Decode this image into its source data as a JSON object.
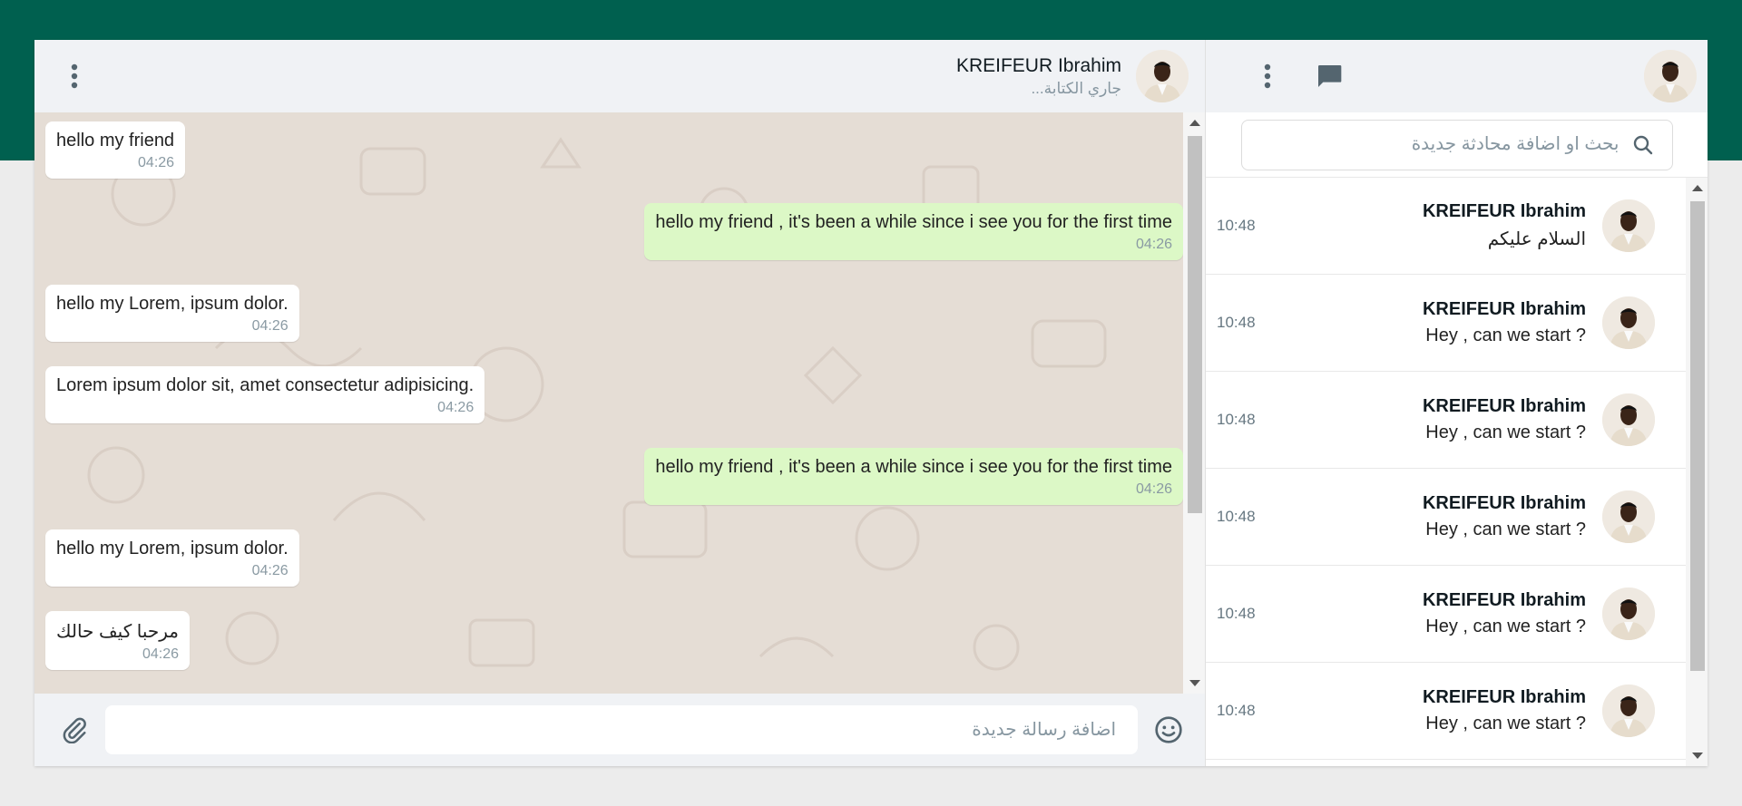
{
  "chat": {
    "contact_name": "KREIFEUR Ibrahim",
    "contact_status": "جاري الكتابة...",
    "messages": [
      {
        "text": "hello my friend",
        "time": "04:26",
        "direction": "in"
      },
      {
        "text": "hello my friend , it's been a while since i see you for the first time",
        "time": "04:26",
        "direction": "out"
      },
      {
        "text": "hello my Lorem, ipsum dolor.",
        "time": "04:26",
        "direction": "in"
      },
      {
        "text": "Lorem ipsum dolor sit, amet consectetur adipisicing.",
        "time": "04:26",
        "direction": "in"
      },
      {
        "text": "hello my friend , it's been a while since i see you for the first time",
        "time": "04:26",
        "direction": "out"
      },
      {
        "text": "hello my Lorem, ipsum dolor.",
        "time": "04:26",
        "direction": "in"
      },
      {
        "text": "مرحبا كيف حالك",
        "time": "04:26",
        "direction": "in"
      }
    ],
    "composer_placeholder": "اضافة رسالة جديدة"
  },
  "sidebar": {
    "search_placeholder": "بحث او اضافة محادثة جديدة",
    "conversations": [
      {
        "name": "KREIFEUR Ibrahim",
        "preview": "السلام عليكم",
        "time": "10:48"
      },
      {
        "name": "KREIFEUR Ibrahim",
        "preview": "Hey , can we start ?",
        "time": "10:48"
      },
      {
        "name": "KREIFEUR Ibrahim",
        "preview": "Hey , can we start ?",
        "time": "10:48"
      },
      {
        "name": "KREIFEUR Ibrahim",
        "preview": "Hey , can we start ?",
        "time": "10:48"
      },
      {
        "name": "KREIFEUR Ibrahim",
        "preview": "Hey , can we start ?",
        "time": "10:48"
      },
      {
        "name": "KREIFEUR Ibrahim",
        "preview": "Hey , can we start ?",
        "time": "10:48"
      }
    ]
  },
  "colors": {
    "brand": "#00604f",
    "outgoing_bubble": "#dcf8c6",
    "incoming_bubble": "#ffffff",
    "chat_background": "#e5ddd5"
  },
  "icons": {
    "chat_menu": "vertical-dots-icon",
    "side_menu": "vertical-dots-icon",
    "new_chat": "chat-bubble-icon",
    "search": "search-icon",
    "attach": "paperclip-icon",
    "emoji": "smiley-icon"
  }
}
